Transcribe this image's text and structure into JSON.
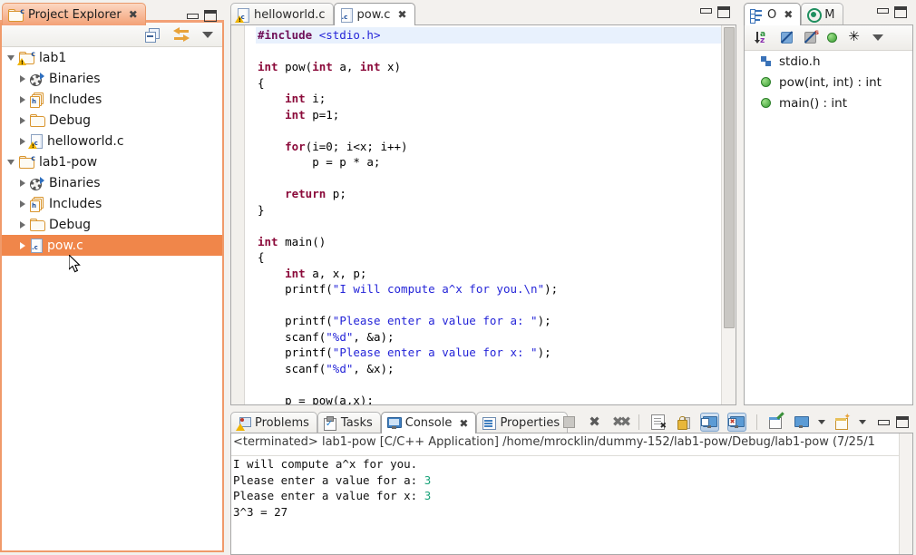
{
  "explorer": {
    "tab_label": "Project Explorer",
    "close_glyph": "✖",
    "toolbar": {
      "collapse_all": "collapse-all",
      "link_with_editor": "link-with-editor",
      "view_menu": "view-menu"
    },
    "tree": [
      {
        "label": "lab1",
        "icon": "c-project-icon",
        "expanded": true,
        "depth": 0,
        "selected": false,
        "warn": true
      },
      {
        "label": "Binaries",
        "icon": "binaries-icon",
        "expanded": false,
        "depth": 1,
        "selected": false
      },
      {
        "label": "Includes",
        "icon": "includes-icon",
        "expanded": false,
        "depth": 1,
        "selected": false
      },
      {
        "label": "Debug",
        "icon": "folder-icon",
        "expanded": false,
        "depth": 1,
        "selected": false
      },
      {
        "label": "helloworld.c",
        "icon": "c-file-icon",
        "expanded": false,
        "depth": 1,
        "selected": false,
        "warn": true
      },
      {
        "label": "lab1-pow",
        "icon": "c-project-icon",
        "expanded": true,
        "depth": 0,
        "selected": false
      },
      {
        "label": "Binaries",
        "icon": "binaries-icon",
        "expanded": false,
        "depth": 1,
        "selected": false
      },
      {
        "label": "Includes",
        "icon": "includes-icon",
        "expanded": false,
        "depth": 1,
        "selected": false
      },
      {
        "label": "Debug",
        "icon": "folder-icon",
        "expanded": false,
        "depth": 1,
        "selected": false
      },
      {
        "label": "pow.c",
        "icon": "c-file-icon",
        "expanded": false,
        "depth": 1,
        "selected": true
      }
    ]
  },
  "editor": {
    "tabs": [
      {
        "label": "helloworld.c",
        "active": false,
        "closable": false,
        "warn": true
      },
      {
        "label": "pow.c",
        "active": true,
        "closable": true,
        "warn": false
      }
    ],
    "close_glyph": "✖",
    "code_lines": [
      [
        {
          "t": "#include ",
          "c": "pp"
        },
        {
          "t": "<stdio.h>",
          "c": "str"
        }
      ],
      [],
      [
        {
          "t": "int",
          "c": "kw"
        },
        {
          "t": " pow(",
          "c": ""
        },
        {
          "t": "int",
          "c": "kw"
        },
        {
          "t": " a, ",
          "c": ""
        },
        {
          "t": "int",
          "c": "kw"
        },
        {
          "t": " x)",
          "c": ""
        }
      ],
      [
        {
          "t": "{",
          "c": ""
        }
      ],
      [
        {
          "t": "    ",
          "c": ""
        },
        {
          "t": "int",
          "c": "kw"
        },
        {
          "t": " i;",
          "c": ""
        }
      ],
      [
        {
          "t": "    ",
          "c": ""
        },
        {
          "t": "int",
          "c": "kw"
        },
        {
          "t": " p=1;",
          "c": ""
        }
      ],
      [],
      [
        {
          "t": "    ",
          "c": ""
        },
        {
          "t": "for",
          "c": "kw"
        },
        {
          "t": "(i=0; i<x; i++)",
          "c": ""
        }
      ],
      [
        {
          "t": "        p = p * a;",
          "c": ""
        }
      ],
      [],
      [
        {
          "t": "    ",
          "c": ""
        },
        {
          "t": "return",
          "c": "kw"
        },
        {
          "t": " p;",
          "c": ""
        }
      ],
      [
        {
          "t": "}",
          "c": ""
        }
      ],
      [],
      [
        {
          "t": "int",
          "c": "kw"
        },
        {
          "t": " main()",
          "c": ""
        }
      ],
      [
        {
          "t": "{",
          "c": ""
        }
      ],
      [
        {
          "t": "    ",
          "c": ""
        },
        {
          "t": "int",
          "c": "kw"
        },
        {
          "t": " a, x, p;",
          "c": ""
        }
      ],
      [
        {
          "t": "    printf(",
          "c": ""
        },
        {
          "t": "\"I will compute a^x for you.\\n\"",
          "c": "str"
        },
        {
          "t": ");",
          "c": ""
        }
      ],
      [],
      [
        {
          "t": "    printf(",
          "c": ""
        },
        {
          "t": "\"Please enter a value for a: \"",
          "c": "str"
        },
        {
          "t": ");",
          "c": ""
        }
      ],
      [
        {
          "t": "    scanf(",
          "c": ""
        },
        {
          "t": "\"%d\"",
          "c": "str"
        },
        {
          "t": ", &a);",
          "c": ""
        }
      ],
      [
        {
          "t": "    printf(",
          "c": ""
        },
        {
          "t": "\"Please enter a value for x: \"",
          "c": "str"
        },
        {
          "t": ");",
          "c": ""
        }
      ],
      [
        {
          "t": "    scanf(",
          "c": ""
        },
        {
          "t": "\"%d\"",
          "c": "str"
        },
        {
          "t": ", &x);",
          "c": ""
        }
      ],
      [],
      [
        {
          "t": "    p = pow(a,x);",
          "c": ""
        }
      ]
    ],
    "highlight_line_index": 0
  },
  "outline": {
    "tabs": [
      {
        "label": "O",
        "active": true,
        "closable": true,
        "icon": "outline-icon"
      },
      {
        "label": "M",
        "active": false,
        "closable": false,
        "icon": "make-target-icon"
      }
    ],
    "close_glyph": "✖",
    "toolbar": [
      "sort-alphabetically-icon",
      "hide-fields-icon",
      "hide-static-members-icon",
      "hide-non-public-icon",
      "filter-icon",
      "view-menu-icon"
    ],
    "items": [
      {
        "label": "stdio.h",
        "icon": "include-header-icon"
      },
      {
        "label": "pow(int, int) : int",
        "icon": "public-method-icon"
      },
      {
        "label": "main() : int",
        "icon": "public-method-icon"
      }
    ]
  },
  "console": {
    "tabs": [
      {
        "label": "Problems",
        "active": false,
        "closable": false,
        "icon": "problems-icon"
      },
      {
        "label": "Tasks",
        "active": false,
        "closable": false,
        "icon": "tasks-icon"
      },
      {
        "label": "Console",
        "active": true,
        "closable": true,
        "icon": "console-icon"
      },
      {
        "label": "Properties",
        "active": false,
        "closable": false,
        "icon": "properties-icon"
      }
    ],
    "close_glyph": "✖",
    "toolbar": [
      "terminate-button",
      "remove-launch-button",
      "remove-all-terminated-button",
      "clear-console-button",
      "scroll-lock-button",
      "show-console-on-output-button",
      "show-console-on-error-button",
      "open-console-button",
      "display-selected-console-button",
      "new-console-view-button"
    ],
    "header": "<terminated> lab1-pow [C/C++ Application] /home/mrocklin/dummy-152/lab1-pow/Debug/lab1-pow (7/25/1",
    "lines": [
      {
        "out": "I will compute a^x for you.",
        "in": ""
      },
      {
        "out": "Please enter a value for a: ",
        "in": "3"
      },
      {
        "out": "Please enter a value for x: ",
        "in": "3"
      },
      {
        "out": "3^3 = 27",
        "in": ""
      }
    ]
  },
  "window": {
    "minimize_label": "Minimize",
    "maximize_label": "Maximize"
  },
  "colors": {
    "active_view_orange": "#f3a176",
    "selection_orange": "#f0864a",
    "keyword": "#8b0a3a",
    "string": "#2424d8",
    "preprocessor": "#6f0f57",
    "console_input_green": "#1aa37a",
    "current_line_highlight": "#e8f1fd"
  }
}
